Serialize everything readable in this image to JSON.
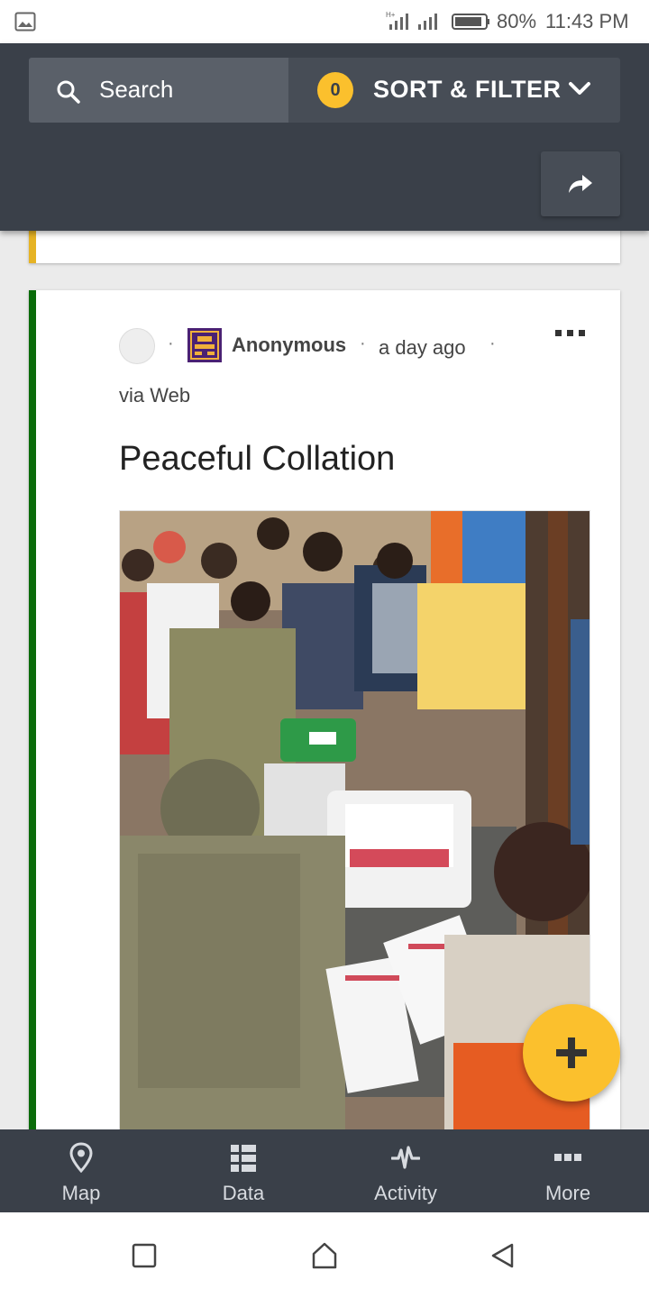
{
  "status_bar": {
    "battery": "80%",
    "time": "11:43 PM",
    "icons": [
      "gallery-icon",
      "signal-icon",
      "battery-icon"
    ]
  },
  "header": {
    "search_placeholder": "Search",
    "filter_count": "0",
    "sort_filter_label": "SORT & FILTER",
    "share_icon": "share-icon"
  },
  "post": {
    "author": "Anonymous",
    "time_ago": "a day ago",
    "via": "via Web",
    "title": "Peaceful Collation",
    "accent_color": "#0a6b0a",
    "image": "photo of people around ballot boxes with ballot papers"
  },
  "previous_post": {
    "accent_color": "#e6b324"
  },
  "fab": {
    "icon": "plus-icon",
    "color": "#fbc02d"
  },
  "bottom_nav": {
    "items": [
      {
        "label": "Map",
        "icon": "map-pin-icon"
      },
      {
        "label": "Data",
        "icon": "data-list-icon"
      },
      {
        "label": "Activity",
        "icon": "activity-icon"
      },
      {
        "label": "More",
        "icon": "more-icon"
      }
    ]
  },
  "system_nav": {
    "icons": [
      "recents-icon",
      "home-icon",
      "back-icon"
    ]
  }
}
